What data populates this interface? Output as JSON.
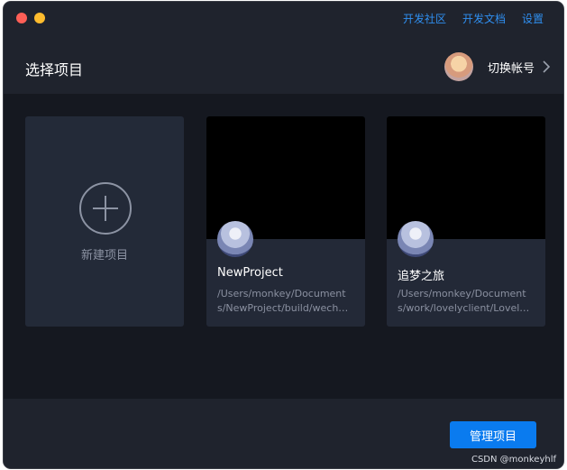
{
  "window": {
    "controls": [
      {
        "name": "close",
        "color": "#fe5f57"
      },
      {
        "name": "minimize",
        "color": "#febc2e"
      }
    ]
  },
  "topnav": {
    "links": [
      "开发社区",
      "开发文档",
      "设置"
    ]
  },
  "header": {
    "title": "选择项目",
    "switch_account_label": "切换帐号"
  },
  "new_project": {
    "label": "新建项目"
  },
  "projects": [
    {
      "name": "NewProject",
      "path_line1": "/Users/monkey/Document",
      "path_line2": "s/NewProject/build/wech…"
    },
    {
      "name": "追梦之旅",
      "path_line1": "/Users/monkey/Document",
      "path_line2": "s/work/lovelyclient/Lovel…"
    }
  ],
  "footer": {
    "manage_button": "管理项目",
    "watermark": "CSDN @monkeyhlf"
  },
  "colors": {
    "accent": "#0a7bef",
    "link": "#2f8ff0",
    "background": "#1a1d26"
  }
}
